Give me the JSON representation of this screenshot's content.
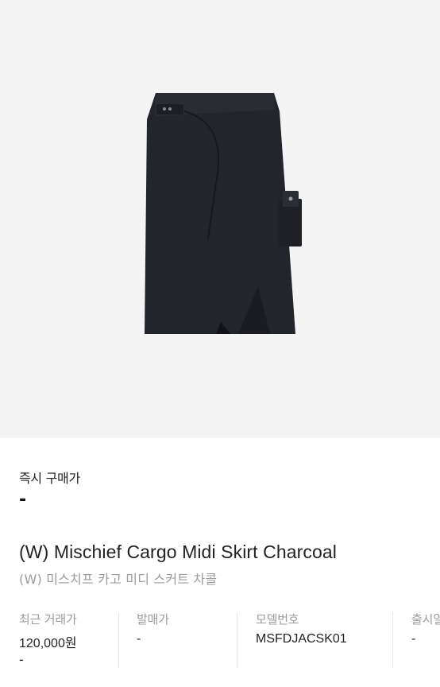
{
  "product": {
    "image_alt": "skirt product image",
    "instant_price_label": "즉시 구매가",
    "instant_price_value": "-",
    "title_en": "(W) Mischief Cargo Midi Skirt Charcoal",
    "title_ko": "(W) 미스치프 카고 미디 스커트 차콜"
  },
  "details": [
    {
      "label": "최근 거래가",
      "value": "120,000원",
      "sub": "-"
    },
    {
      "label": "발매가",
      "value": "-"
    },
    {
      "label": "모델번호",
      "value": "MSFDJACSK01"
    },
    {
      "label": "출시일",
      "value": "-"
    }
  ],
  "colors": {
    "image_bg": "#f4f4f4",
    "skirt": "#23252c",
    "text_primary": "#222222",
    "text_secondary": "#9b9b9b"
  }
}
